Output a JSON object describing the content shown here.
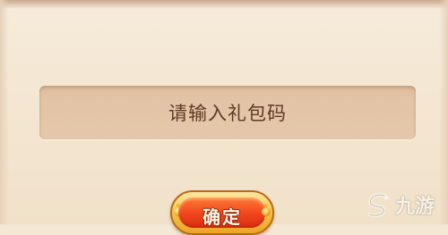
{
  "gift_code_dialog": {
    "input_placeholder": "请输入礼包码",
    "confirm_label": "确定"
  },
  "watermark": {
    "text": "九游",
    "icon": "s-swirl-logo-icon"
  },
  "colors": {
    "panel_background": "#f4e7d3",
    "input_background": "#e3c3a5",
    "placeholder_text": "#5d3a24",
    "button_gold_rim": "#f6c74f",
    "button_red_face": "#f0441c",
    "button_text": "#fff8e6"
  }
}
